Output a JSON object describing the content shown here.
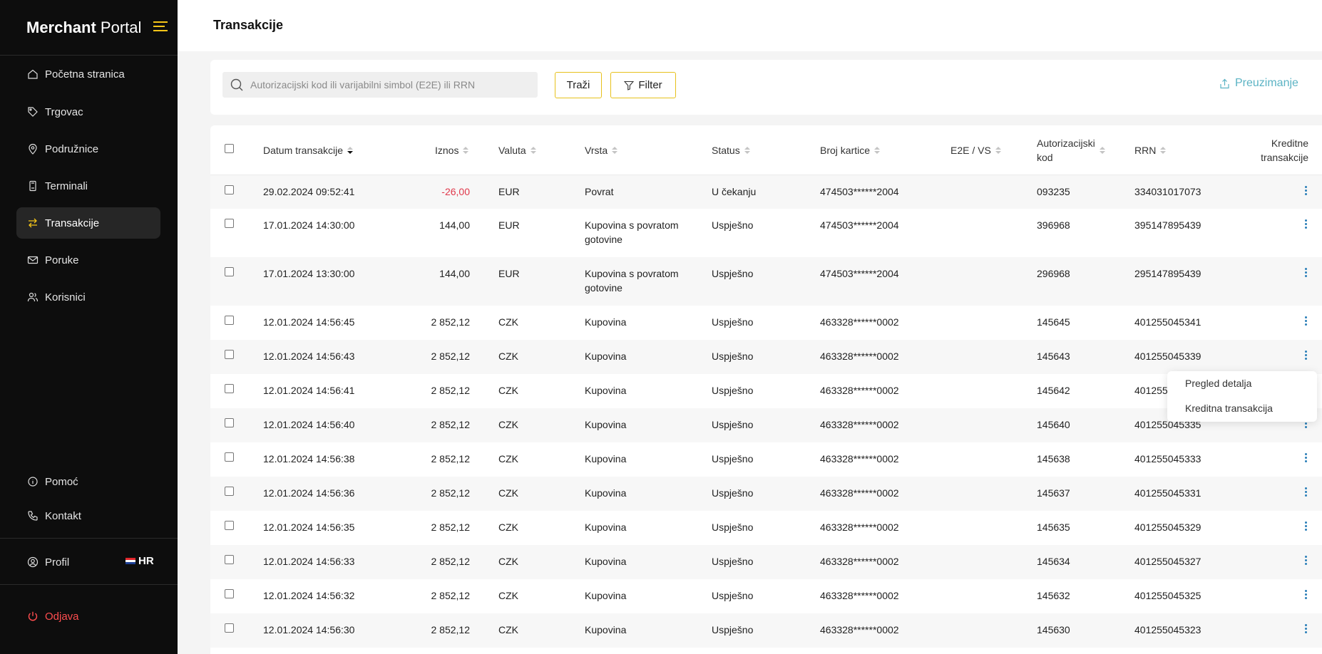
{
  "brand": {
    "bold": "Merchant",
    "light": "Portal"
  },
  "sidebar": {
    "items": [
      {
        "label": "Početna stranica",
        "icon": "home-icon"
      },
      {
        "label": "Trgovac",
        "icon": "tag-icon"
      },
      {
        "label": "Podružnice",
        "icon": "location-pin-icon"
      },
      {
        "label": "Terminali",
        "icon": "terminal-icon"
      },
      {
        "label": "Transakcije",
        "icon": "transfer-arrows-icon",
        "active": true
      },
      {
        "label": "Poruke",
        "icon": "mail-icon"
      },
      {
        "label": "Korisnici",
        "icon": "users-icon"
      }
    ],
    "help": "Pomoć",
    "contact": "Kontakt",
    "profile": "Profil",
    "language": "HR",
    "logout": "Odjava"
  },
  "header": {
    "title": "Transakcije"
  },
  "search": {
    "placeholder": "Autorizacijski kod ili varijabilni simbol (E2E) ili RRN",
    "search_button": "Traži",
    "filter_button": "Filter",
    "download_link": "Preuzimanje"
  },
  "table": {
    "columns": {
      "date": "Datum transakcije",
      "amount": "Iznos",
      "currency": "Valuta",
      "type": "Vrsta",
      "status": "Status",
      "card": "Broj kartice",
      "e2e": "E2E / VS",
      "auth_line1": "Autorizacijski",
      "auth_line2": "kod",
      "rrn": "RRN",
      "credit_line1": "Kreditne",
      "credit_line2": "transakcije"
    },
    "rows": [
      {
        "date": "29.02.2024 09:52:41",
        "amount": "-26,00",
        "currency": "EUR",
        "type1": "Povrat",
        "type2": "",
        "status": "U čekanju",
        "card": "474503******2004",
        "e2e": "",
        "auth": "093235",
        "rrn": "334031017073"
      },
      {
        "date": "17.01.2024 14:30:00",
        "amount": "144,00",
        "currency": "EUR",
        "type1": "Kupovina s povratom",
        "type2": "gotovine",
        "status": "Uspješno",
        "card": "474503******2004",
        "e2e": "",
        "auth": "396968",
        "rrn": "395147895439"
      },
      {
        "date": "17.01.2024 13:30:00",
        "amount": "144,00",
        "currency": "EUR",
        "type1": "Kupovina s povratom",
        "type2": "gotovine",
        "status": "Uspješno",
        "card": "474503******2004",
        "e2e": "",
        "auth": "296968",
        "rrn": "295147895439"
      },
      {
        "date": "12.01.2024 14:56:45",
        "amount": "2 852,12",
        "currency": "CZK",
        "type1": "Kupovina",
        "type2": "",
        "status": "Uspješno",
        "card": "463328******0002",
        "e2e": "",
        "auth": "145645",
        "rrn": "401255045341"
      },
      {
        "date": "12.01.2024 14:56:43",
        "amount": "2 852,12",
        "currency": "CZK",
        "type1": "Kupovina",
        "type2": "",
        "status": "Uspješno",
        "card": "463328******0002",
        "e2e": "",
        "auth": "145643",
        "rrn": "401255045339"
      },
      {
        "date": "12.01.2024 14:56:41",
        "amount": "2 852,12",
        "currency": "CZK",
        "type1": "Kupovina",
        "type2": "",
        "status": "Uspješno",
        "card": "463328******0002",
        "e2e": "",
        "auth": "145642",
        "rrn": "401255"
      },
      {
        "date": "12.01.2024 14:56:40",
        "amount": "2 852,12",
        "currency": "CZK",
        "type1": "Kupovina",
        "type2": "",
        "status": "Uspješno",
        "card": "463328******0002",
        "e2e": "",
        "auth": "145640",
        "rrn": "401255045335"
      },
      {
        "date": "12.01.2024 14:56:38",
        "amount": "2 852,12",
        "currency": "CZK",
        "type1": "Kupovina",
        "type2": "",
        "status": "Uspješno",
        "card": "463328******0002",
        "e2e": "",
        "auth": "145638",
        "rrn": "401255045333"
      },
      {
        "date": "12.01.2024 14:56:36",
        "amount": "2 852,12",
        "currency": "CZK",
        "type1": "Kupovina",
        "type2": "",
        "status": "Uspješno",
        "card": "463328******0002",
        "e2e": "",
        "auth": "145637",
        "rrn": "401255045331"
      },
      {
        "date": "12.01.2024 14:56:35",
        "amount": "2 852,12",
        "currency": "CZK",
        "type1": "Kupovina",
        "type2": "",
        "status": "Uspješno",
        "card": "463328******0002",
        "e2e": "",
        "auth": "145635",
        "rrn": "401255045329"
      },
      {
        "date": "12.01.2024 14:56:33",
        "amount": "2 852,12",
        "currency": "CZK",
        "type1": "Kupovina",
        "type2": "",
        "status": "Uspješno",
        "card": "463328******0002",
        "e2e": "",
        "auth": "145634",
        "rrn": "401255045327"
      },
      {
        "date": "12.01.2024 14:56:32",
        "amount": "2 852,12",
        "currency": "CZK",
        "type1": "Kupovina",
        "type2": "",
        "status": "Uspješno",
        "card": "463328******0002",
        "e2e": "",
        "auth": "145632",
        "rrn": "401255045325"
      },
      {
        "date": "12.01.2024 14:56:30",
        "amount": "2 852,12",
        "currency": "CZK",
        "type1": "Kupovina",
        "type2": "",
        "status": "Uspješno",
        "card": "463328******0002",
        "e2e": "",
        "auth": "145630",
        "rrn": "401255045323"
      }
    ]
  },
  "dropdown": {
    "view_details": "Pregled detalja",
    "credit_transaction": "Kreditna transakcija"
  },
  "colors": {
    "accent": "#f5c518",
    "negative": "#e0384b",
    "link": "#5bb3c4",
    "logout": "#ff4d4f",
    "sidebar_bg": "#0d0d0d"
  }
}
